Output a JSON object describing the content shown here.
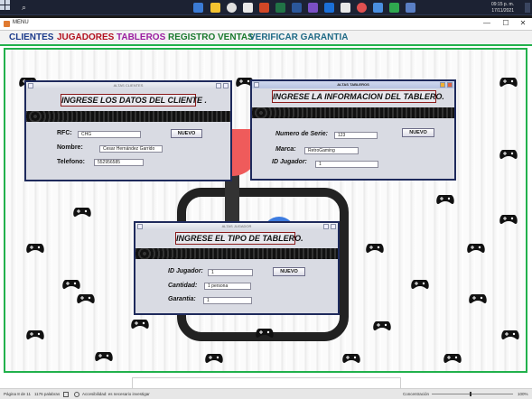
{
  "taskbar": {
    "time": "09:15 p. m.",
    "date": "17/11/2021"
  },
  "window": {
    "title": "MENU",
    "controls": [
      "—",
      "☐",
      "✕"
    ]
  },
  "menu": {
    "items": [
      {
        "label": "CLIENTES",
        "color": "#1b3a8a"
      },
      {
        "label": "JUGADORES",
        "color": "#b3121f"
      },
      {
        "label": "TABLEROS",
        "color": "#9b1ea0"
      },
      {
        "label": "REGISTRO VENTAS",
        "color": "#1b7a2e"
      },
      {
        "label": "VERIFICAR GARANTIA",
        "color": "#1f6a86"
      }
    ]
  },
  "clientes": {
    "title": "ALTAS CLIENTES",
    "heading": "INGRESE LOS DATOS DEL CLIENTE .",
    "rfc_label": "RFC:",
    "rfc_value": "CHG",
    "nombre_label": "Nombre:",
    "nombre_value": "Cesar Hernández Garrido",
    "telefono_label": "Telefono:",
    "telefono_value": "552956585",
    "button": "NUEVO"
  },
  "tableros": {
    "title": "ALTAS TABLEROS",
    "heading": "INGRESE LA INFORMACION DEL TABLERO.",
    "serie_label": "Numero de Serie:",
    "serie_value": "123",
    "marca_label": "Marca:",
    "marca_value": "RetroGaming",
    "jugador_label": "ID Jugador:",
    "jugador_value": "1",
    "button": "NUEVO"
  },
  "jugadores": {
    "title": "ALTAS JUGADOR",
    "heading": "INGRESE EL TIPO DE TABLERO.",
    "id_label": "ID Jugador:",
    "id_value": "1",
    "cantidad_label": "Cantidad:",
    "cantidad_value": "1 persona",
    "garantia_label": "Garantia:",
    "garantia_value": "1",
    "button": "NUEVO"
  },
  "statusbar": {
    "page": "Página 8 de 11",
    "words": "1176 palabras",
    "accessibility": "Accesibilidad: es necesario investigar",
    "focus": "Concentración",
    "zoom": "100%"
  }
}
